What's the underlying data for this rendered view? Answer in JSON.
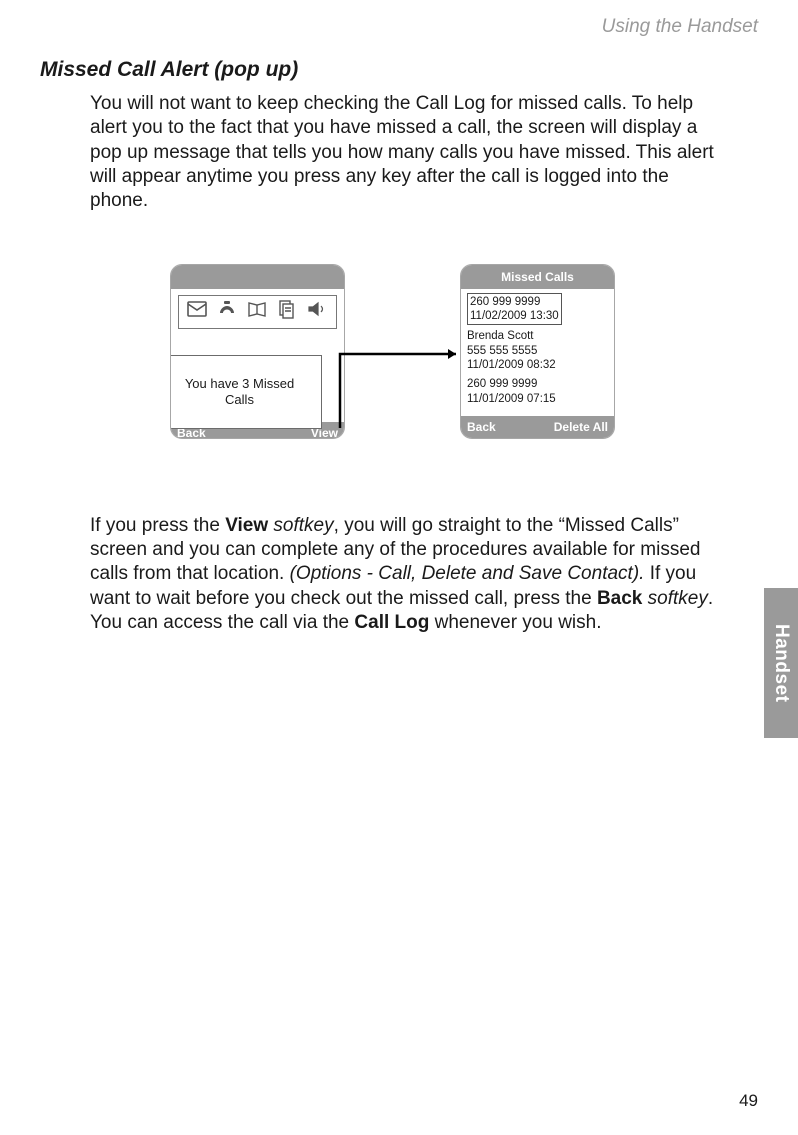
{
  "header": {
    "running": "Using the Handset"
  },
  "section": {
    "title": "Missed Call Alert (pop up)"
  },
  "para1": "You will not want to keep checking the Call Log for missed calls. To help alert you to the fact that you have missed a call, the screen will display a pop up message that tells you how many calls you have missed. This alert will appear anytime you press any key after the call is logged into the phone.",
  "para2": {
    "t1": "If you press the ",
    "b1": "View",
    "i1": " softkey",
    "t2": ", you will go straight to the “Missed Calls” screen and you can complete any of the procedures available for missed calls from that location. ",
    "i2": "(Options - Call, Delete and Save Contact).",
    "t3": " If you want to wait before you check out the missed call, press the ",
    "b2": "Back",
    "i3": " softkey",
    "t4": ". You can access the call via the ",
    "b3": "Call Log",
    "t5": " whenever you wish."
  },
  "tab": {
    "label": "Handset"
  },
  "pageNumber": "49",
  "figure": {
    "left": {
      "popup": "You have 3 Missed Calls",
      "softLeft": "Back",
      "softRight": "View"
    },
    "right": {
      "title": "Missed Calls",
      "softLeft": "Back",
      "softRight": "Delete All",
      "items": [
        {
          "line1": "260 999 9999",
          "line2": "11/02/2009 13:30",
          "selected": true
        },
        {
          "line1": "Brenda Scott",
          "line2": "555 555 5555",
          "line3": "11/01/2009 08:32"
        },
        {
          "line1": "260 999 9999",
          "line2": "11/01/2009 07:15"
        }
      ]
    }
  }
}
